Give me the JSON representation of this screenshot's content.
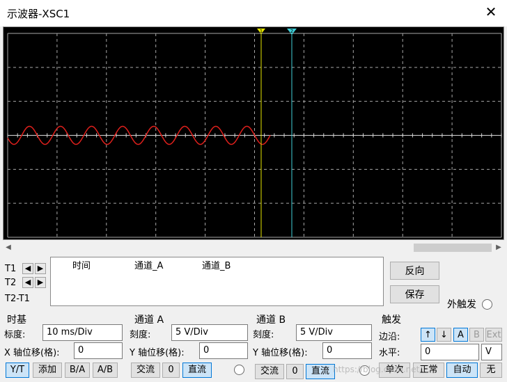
{
  "window": {
    "title": "示波器-XSC1",
    "close_glyph": "✕"
  },
  "scope": {
    "background": "#000000",
    "grid_color": "#a8a8a8",
    "trace_color": "#e0201c",
    "cursor1_color": "#e6e600",
    "cursor2_color": "#40d0d8",
    "cursor1_marker": "1",
    "cursor2_marker": "2"
  },
  "cursors": {
    "t1_label": "T1",
    "t2_label": "T2",
    "diff_label": "T2-T1",
    "left_glyph": "◀",
    "right_glyph": "▶"
  },
  "readout": {
    "col_time": "时间",
    "col_a": "通道_A",
    "col_b": "通道_B"
  },
  "actions": {
    "reverse": "反向",
    "save": "保存",
    "ext_trigger": "外触发"
  },
  "timebase": {
    "title": "时基",
    "scale_label": "标度:",
    "scale_value": "10 ms/Div",
    "xpos_label": "X 轴位移(格):",
    "xpos_value": "0",
    "modes": [
      "Y/T",
      "添加",
      "B/A",
      "A/B"
    ]
  },
  "channel_a": {
    "title": "通道 A",
    "scale_label": "刻度:",
    "scale_value": "5  V/Div",
    "ypos_label": "Y 轴位移(格):",
    "ypos_value": "0",
    "coupling": [
      "交流",
      "0",
      "直流"
    ]
  },
  "channel_b": {
    "title": "通道 B",
    "scale_label": "刻度:",
    "scale_value": "5  V/Div",
    "ypos_label": "Y 轴位移(格):",
    "ypos_value": "0",
    "coupling": [
      "交流",
      "0",
      "直流"
    ]
  },
  "trigger": {
    "title": "触发",
    "edge_label": "边沿:",
    "rising_glyph": "↑",
    "falling_glyph": "↓",
    "sources": [
      "A",
      "B",
      "Ext"
    ],
    "level_label": "水平:",
    "level_value": "0",
    "level_unit": "V",
    "modes": [
      "单次",
      "正常",
      "自动",
      "无"
    ]
  },
  "watermark": "https://blog.csdn.net/..."
}
